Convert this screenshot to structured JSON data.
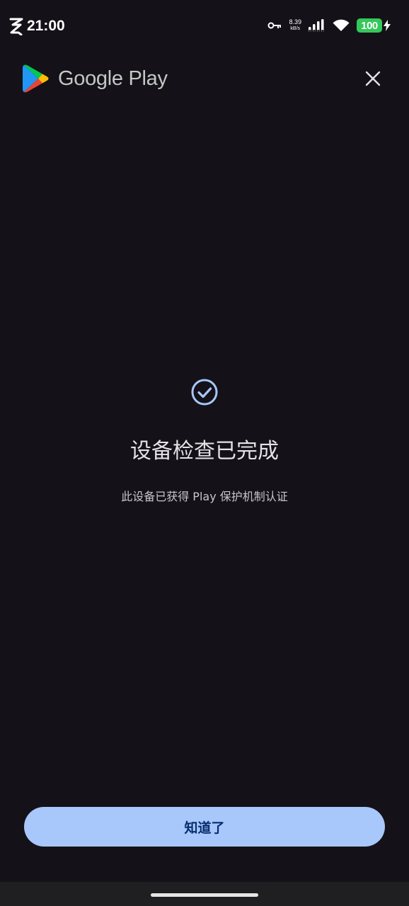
{
  "status_bar": {
    "time": "21:00",
    "net_speed_value": "8.39",
    "net_speed_unit": "kB/s",
    "battery_level": "100",
    "icons": [
      "app-logo-icon",
      "vpn-key-icon",
      "signal-icon",
      "wifi-icon",
      "battery-icon",
      "charging-bolt-icon"
    ]
  },
  "header": {
    "brand_name": "Google Play",
    "logo_icon": "google-play-logo-icon",
    "close_icon": "close-icon"
  },
  "main": {
    "status_icon": "check-circle-icon",
    "title": "设备检查已完成",
    "subtitle": "此设备已获得 Play 保护机制认证"
  },
  "actions": {
    "ok_label": "知道了"
  },
  "colors": {
    "background": "#141218",
    "accent": "#a8c7fa",
    "button_text": "#062e6f",
    "battery": "#34c759"
  }
}
